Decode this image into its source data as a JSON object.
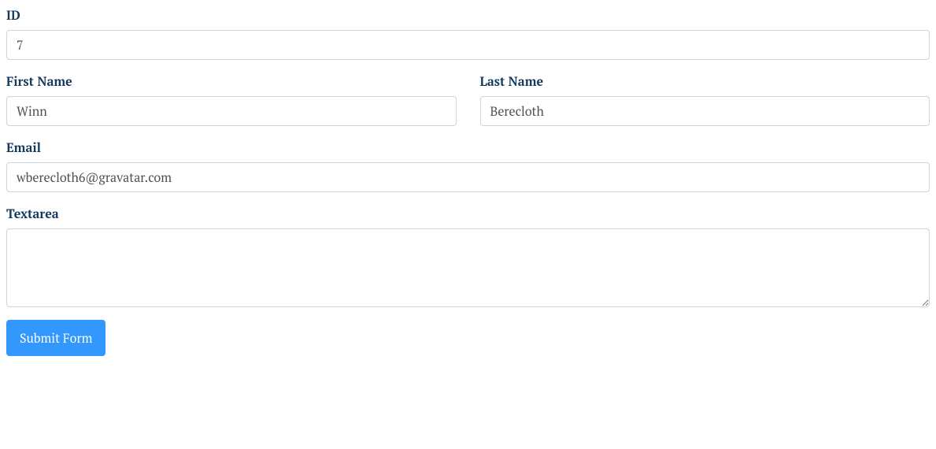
{
  "form": {
    "id": {
      "label": "ID",
      "value": "7"
    },
    "firstName": {
      "label": "First Name",
      "value": "Winn"
    },
    "lastName": {
      "label": "Last Name",
      "value": "Berecloth"
    },
    "email": {
      "label": "Email",
      "value": "wberecloth6@gravatar.com"
    },
    "textarea": {
      "label": "Textarea",
      "value": ""
    },
    "submit": {
      "label": "Submit Form"
    }
  }
}
